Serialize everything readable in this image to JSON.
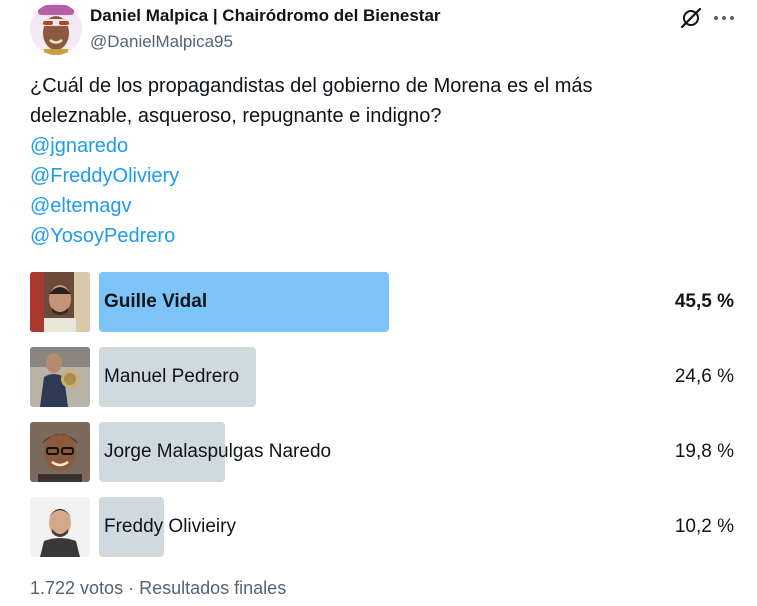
{
  "author": {
    "name": "Daniel Malpica | Chairódromo del Bienestar",
    "handle": "@DanielMalpica95"
  },
  "tweet": {
    "text_line1": "¿Cuál de los propagandistas del gobierno de Morena es el más",
    "text_line2": "deleznable, asqueroso, repugnante e indigno?",
    "mentions": [
      "@jgnaredo",
      "@FreddyOliviery",
      "@eltemagv",
      "@YosoyPedrero"
    ]
  },
  "poll": {
    "options": [
      {
        "label": "Guille Vidal",
        "percent": "45,5 %",
        "share": 0.455,
        "winner": true
      },
      {
        "label": "Manuel Pedrero",
        "percent": "24,6 %",
        "share": 0.246,
        "winner": false
      },
      {
        "label": "Jorge Malaspulgas Naredo",
        "percent": "19,8 %",
        "share": 0.198,
        "winner": false
      },
      {
        "label": "Freddy Olivieiry",
        "percent": "10,2 %",
        "share": 0.102,
        "winner": false
      }
    ],
    "votes": "1.722 votos",
    "separator": "·",
    "status": "Resultados finales"
  },
  "icons": {
    "top_right": [
      "grok-icon",
      "more-icon"
    ]
  },
  "colors": {
    "winner_bar": "#7cc4f8",
    "other_bar": "#cfd9de",
    "mention": "#1d9bf0",
    "muted": "#536471"
  }
}
